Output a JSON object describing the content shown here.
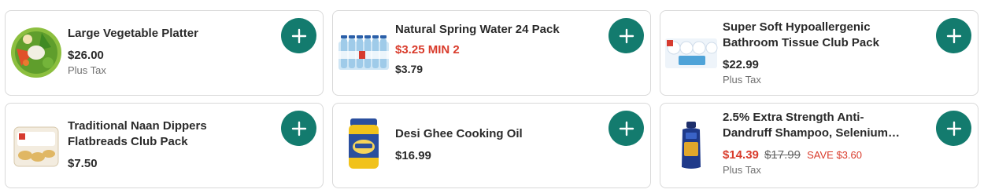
{
  "products": [
    {
      "name": "Large Vegetable Platter",
      "price": "$26.00",
      "tax": "Plus Tax",
      "icon": "vegetable-platter-image"
    },
    {
      "name": "Natural Spring Water 24 Pack",
      "sale_price": "$3.25 MIN 2",
      "regular_price": "$3.79",
      "icon": "water-bottles-image"
    },
    {
      "name": "Super Soft Hypoallergenic Bathroom Tissue Club Pack",
      "name_line1": "Super Soft Hypoallergenic",
      "name_line2": "Bathroom Tissue Club Pack",
      "price": "$22.99",
      "tax": "Plus Tax",
      "icon": "bathroom-tissue-image"
    },
    {
      "name": "Traditional Naan Dippers Flatbreads Club Pack",
      "name_line1": "Traditional Naan Dippers",
      "name_line2": "Flatbreads Club Pack",
      "price": "$7.50",
      "icon": "naan-dippers-image"
    },
    {
      "name": "Desi Ghee Cooking Oil",
      "price": "$16.99",
      "icon": "ghee-jar-image"
    },
    {
      "name_line1": "2.5% Extra Strength Anti-",
      "name_line2": "Dandruff Shampoo, Selenium…",
      "sale_price": "$14.39",
      "was_price": "$17.99",
      "save": "SAVE $3.60",
      "tax": "Plus Tax",
      "icon": "shampoo-bottle-image"
    }
  ],
  "add_button_icon": "plus-icon",
  "colors": {
    "accent": "#137b6e",
    "sale": "#d93b2b",
    "border": "#d9d9d9"
  }
}
